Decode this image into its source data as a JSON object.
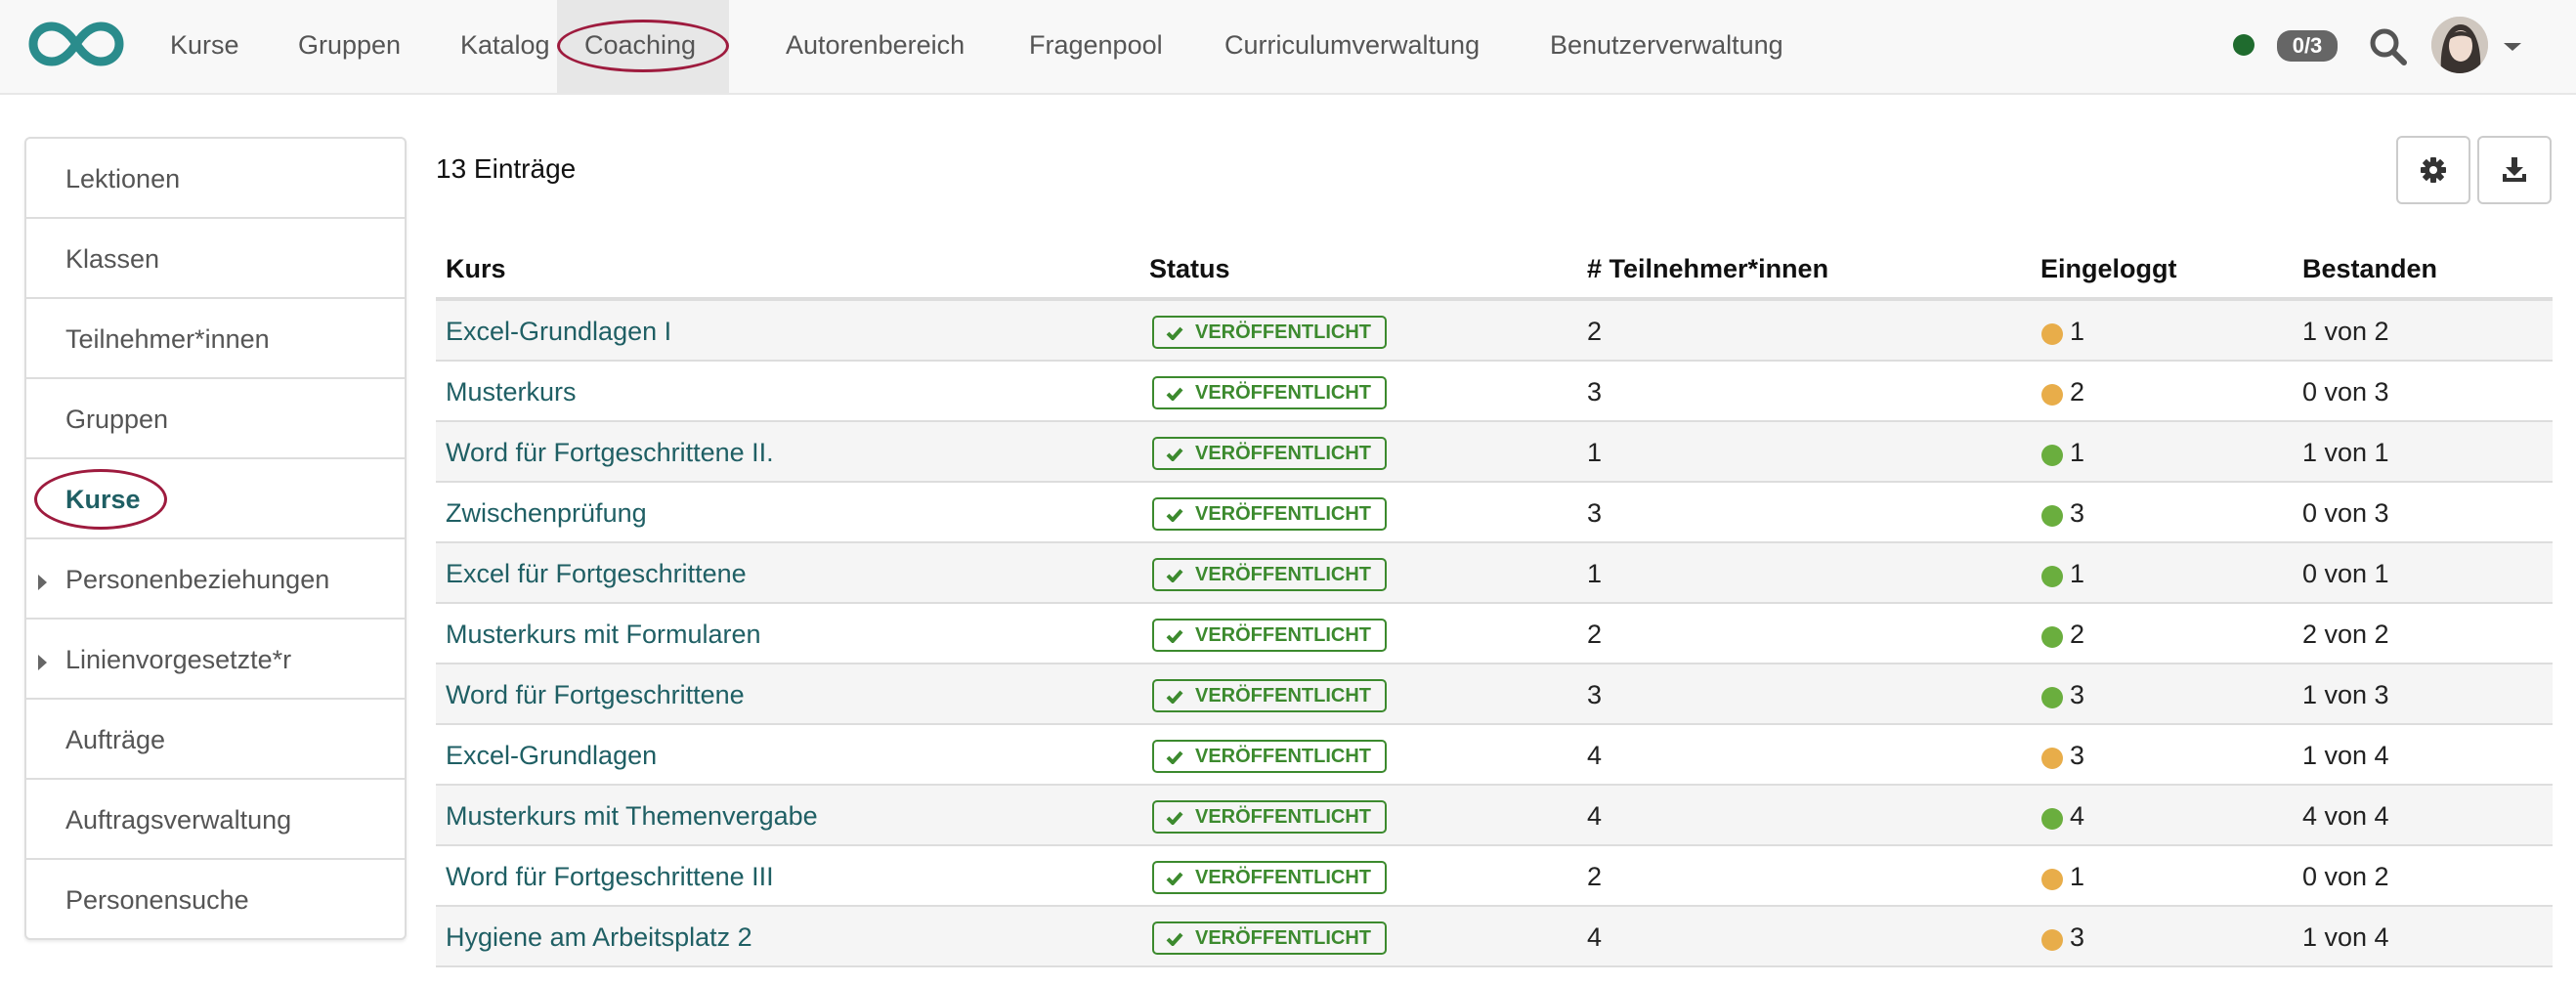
{
  "nav": {
    "items": [
      {
        "label": "Kurse",
        "name": "nav-item-kurse"
      },
      {
        "label": "Gruppen",
        "name": "nav-item-gruppen"
      },
      {
        "label": "Katalog",
        "name": "nav-item-katalog"
      },
      {
        "label": "Coaching",
        "name": "nav-item-coaching",
        "active": true,
        "highlighted": true
      },
      {
        "label": "Autorenbereich",
        "name": "nav-item-autorenbereich"
      },
      {
        "label": "Fragenpool",
        "name": "nav-item-fragenpool"
      },
      {
        "label": "Curriculumverwaltung",
        "name": "nav-item-curriculumverwaltung"
      },
      {
        "label": "Benutzerverwaltung",
        "name": "nav-item-benutzerverwaltung"
      }
    ],
    "online_count": "0/3"
  },
  "sidebar": {
    "items": [
      {
        "label": "Lektionen",
        "name": "sidebar-item-lektionen"
      },
      {
        "label": "Klassen",
        "name": "sidebar-item-klassen"
      },
      {
        "label": "Teilnehmer*innen",
        "name": "sidebar-item-teilnehmer"
      },
      {
        "label": "Gruppen",
        "name": "sidebar-item-gruppen"
      },
      {
        "label": "Kurse",
        "name": "sidebar-item-kurse",
        "active": true,
        "highlighted": true
      },
      {
        "label": "Personenbeziehungen",
        "name": "sidebar-item-personenbeziehungen",
        "expandable": true
      },
      {
        "label": "Linienvorgesetzte*r",
        "name": "sidebar-item-linienvorgesetzte",
        "expandable": true
      },
      {
        "label": "Aufträge",
        "name": "sidebar-item-auftraege"
      },
      {
        "label": "Auftragsverwaltung",
        "name": "sidebar-item-auftragsverwaltung"
      },
      {
        "label": "Personensuche",
        "name": "sidebar-item-personensuche"
      }
    ]
  },
  "main": {
    "entries_label": "13 Einträge",
    "columns": [
      "Kurs",
      "Status",
      "# Teilnehmer*innen",
      "Eingeloggt",
      "Bestanden"
    ],
    "rows": [
      {
        "course": "Excel-Grundlagen I",
        "status": "VERÖFFENTLICHT",
        "participants": "2",
        "logged_in": "1",
        "logged_color": "orange",
        "passed": "1 von 2"
      },
      {
        "course": "Musterkurs",
        "status": "VERÖFFENTLICHT",
        "participants": "3",
        "logged_in": "2",
        "logged_color": "orange",
        "passed": "0 von 3"
      },
      {
        "course": "Word für Fortgeschrittene II.",
        "status": "VERÖFFENTLICHT",
        "participants": "1",
        "logged_in": "1",
        "logged_color": "green",
        "passed": "1 von 1"
      },
      {
        "course": "Zwischenprüfung",
        "status": "VERÖFFENTLICHT",
        "participants": "3",
        "logged_in": "3",
        "logged_color": "green",
        "passed": "0 von 3"
      },
      {
        "course": "Excel für Fortgeschrittene",
        "status": "VERÖFFENTLICHT",
        "participants": "1",
        "logged_in": "1",
        "logged_color": "green",
        "passed": "0 von 1"
      },
      {
        "course": "Musterkurs mit Formularen",
        "status": "VERÖFFENTLICHT",
        "participants": "2",
        "logged_in": "2",
        "logged_color": "green",
        "passed": "2 von 2"
      },
      {
        "course": "Word für Fortgeschrittene",
        "status": "VERÖFFENTLICHT",
        "participants": "3",
        "logged_in": "3",
        "logged_color": "green",
        "passed": "1 von 3"
      },
      {
        "course": "Excel-Grundlagen",
        "status": "VERÖFFENTLICHT",
        "participants": "4",
        "logged_in": "3",
        "logged_color": "orange",
        "passed": "1 von 4"
      },
      {
        "course": "Musterkurs mit Themenvergabe",
        "status": "VERÖFFENTLICHT",
        "participants": "4",
        "logged_in": "4",
        "logged_color": "green",
        "passed": "4 von 4"
      },
      {
        "course": "Word für Fortgeschrittene III",
        "status": "VERÖFFENTLICHT",
        "participants": "2",
        "logged_in": "1",
        "logged_color": "orange",
        "passed": "0 von 2"
      },
      {
        "course": "Hygiene am Arbeitsplatz 2",
        "status": "VERÖFFENTLICHT",
        "participants": "4",
        "logged_in": "3",
        "logged_color": "orange",
        "passed": "1 von 4"
      }
    ]
  },
  "colors": {
    "brand": "#2a8c8c",
    "link": "#1f5f64",
    "published": "#3c8a2e",
    "dot_orange": "#e8ad4a",
    "dot_green": "#6aae3e",
    "highlight": "#9e1b3e"
  },
  "icons": {
    "logo": "infinity-logo-icon",
    "status": "online-status-icon",
    "search": "search-icon",
    "settings": "gear-icon",
    "download": "download-icon",
    "expand": "caret-right-icon",
    "published": "checkmark-icon"
  }
}
